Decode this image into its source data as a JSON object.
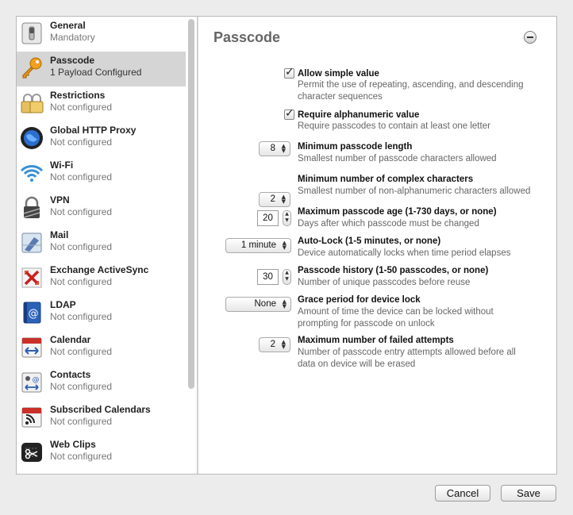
{
  "sidebar": {
    "items": [
      {
        "title": "General",
        "subtitle": "Mandatory",
        "icon": "switch-icon"
      },
      {
        "title": "Passcode",
        "subtitle": "1 Payload Configured",
        "icon": "key-icon",
        "selected": true
      },
      {
        "title": "Restrictions",
        "subtitle": "Not configured",
        "icon": "padlocks-icon"
      },
      {
        "title": "Global HTTP Proxy",
        "subtitle": "Not configured",
        "icon": "globe-icon"
      },
      {
        "title": "Wi-Fi",
        "subtitle": "Not configured",
        "icon": "wifi-icon"
      },
      {
        "title": "VPN",
        "subtitle": "Not configured",
        "icon": "vpn-lock-icon"
      },
      {
        "title": "Mail",
        "subtitle": "Not configured",
        "icon": "mail-icon"
      },
      {
        "title": "Exchange ActiveSync",
        "subtitle": "Not configured",
        "icon": "exchange-icon"
      },
      {
        "title": "LDAP",
        "subtitle": "Not configured",
        "icon": "ldap-book-icon"
      },
      {
        "title": "Calendar",
        "subtitle": "Not configured",
        "icon": "calendar-icon"
      },
      {
        "title": "Contacts",
        "subtitle": "Not configured",
        "icon": "contacts-icon"
      },
      {
        "title": "Subscribed Calendars",
        "subtitle": "Not configured",
        "icon": "subscribed-calendar-icon"
      },
      {
        "title": "Web Clips",
        "subtitle": "Not configured",
        "icon": "web-clip-icon"
      }
    ]
  },
  "main": {
    "title": "Passcode",
    "settings": {
      "allow_simple": {
        "title": "Allow simple value",
        "desc": "Permit the use of repeating, ascending, and descending character sequences",
        "checked": true
      },
      "require_alnum": {
        "title": "Require alphanumeric value",
        "desc": "Require passcodes to contain at least one letter",
        "checked": true
      },
      "min_length": {
        "title": "Minimum passcode length",
        "desc": "Smallest number of passcode characters allowed",
        "value": "8"
      },
      "min_complex": {
        "title": "Minimum number of complex characters",
        "desc": "Smallest number of non-alphanumeric characters allowed",
        "value": "2"
      },
      "max_age": {
        "title": "Maximum passcode age (1-730 days, or none)",
        "desc": "Days after which passcode must be changed",
        "value": "20"
      },
      "auto_lock": {
        "title": "Auto-Lock (1-5 minutes, or none)",
        "desc": "Device automatically locks when time period elapses",
        "value": "1 minute"
      },
      "history": {
        "title": "Passcode history (1-50 passcodes, or none)",
        "desc": "Number of unique passcodes before reuse",
        "value": "30"
      },
      "grace": {
        "title": "Grace period for device lock",
        "desc": "Amount of time the device can be locked without prompting for passcode on unlock",
        "value": "None"
      },
      "failed": {
        "title": "Maximum number of failed attempts",
        "desc": "Number of passcode entry attempts allowed before all data on device will be erased",
        "value": "2"
      }
    }
  },
  "footer": {
    "cancel_label": "Cancel",
    "save_label": "Save"
  }
}
